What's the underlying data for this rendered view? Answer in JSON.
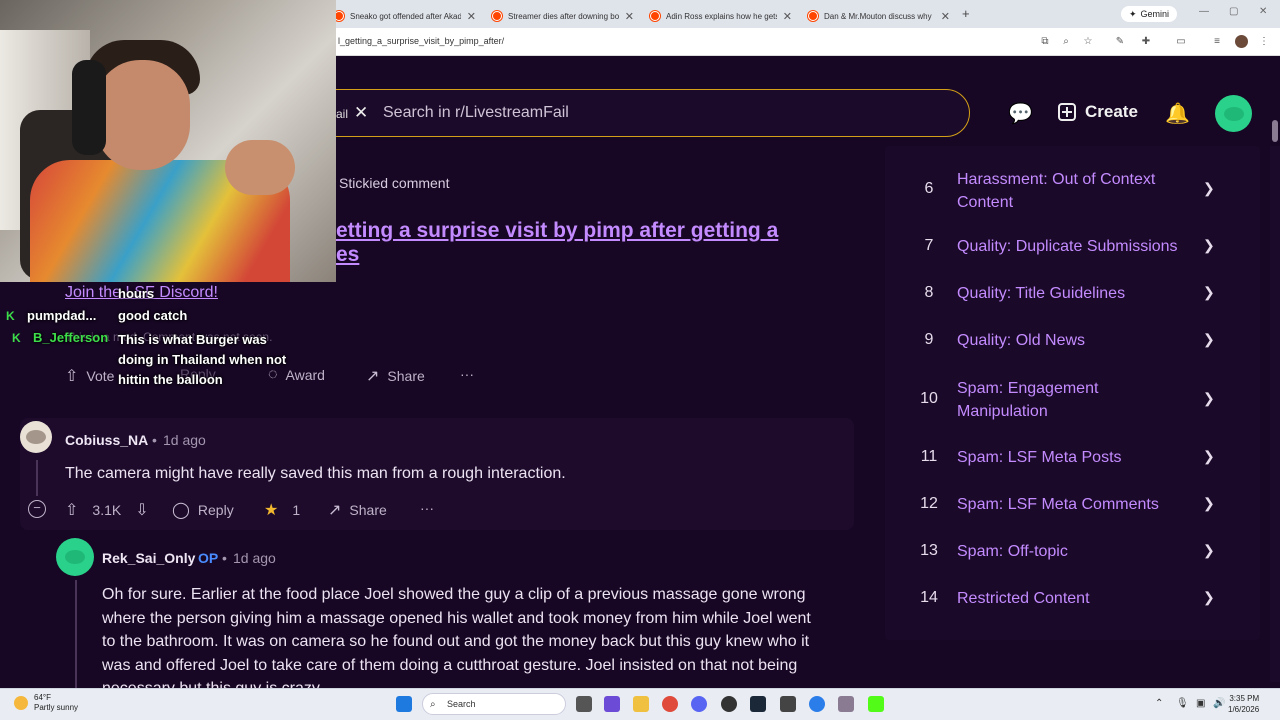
{
  "browser": {
    "tabs": [
      {
        "title": "Sneako got offended after Akad"
      },
      {
        "title": "Streamer dies after downing bo"
      },
      {
        "title": "Adin Ross explains how he gets"
      },
      {
        "title": "Dan & Mr.Mouton discuss why"
      }
    ],
    "new_tab": "+",
    "gemini_label": "Gemini",
    "url": "l_getting_a_surprise_visit_by_pimp_after/"
  },
  "header": {
    "chip_label": "ail",
    "search_placeholder": "Search in r/LivestreamFail",
    "create_label": "Create"
  },
  "chat": [
    {
      "user": "",
      "message": "hours"
    },
    {
      "user": "pumpdad...",
      "message": "good catch"
    },
    {
      "user": "B_Jefferson",
      "message": "This is what Burger was doing in Thailand when not hittin the balloon"
    }
  ],
  "post": {
    "stickied_label": "Stickied comment",
    "title_line1": "etting a surprise visit by pimp after getting a",
    "title_line2": "es",
    "discord_link": "Join the LSF Discord!",
    "faint_text": "This is a mod. Comment was not seen.",
    "actions": {
      "vote": "Vote",
      "reply": "Reply",
      "award": "Award",
      "share": "Share",
      "more": "···"
    }
  },
  "comments": [
    {
      "user": "Cobiuss_NA",
      "sep": "•",
      "time": "1d ago",
      "text": "The camera might have really saved this man from a rough interaction.",
      "votes": "3.1K",
      "reply": "Reply",
      "award_count": "1",
      "share": "Share",
      "more": "···"
    },
    {
      "user": "Rek_Sai_Only",
      "op": "OP",
      "sep": "•",
      "time": "1d ago",
      "lines": [
        "Oh for sure. Earlier at the food place Joel showed the guy a clip of a previous massage gone wrong",
        "where the person giving him a massage opened his wallet and took money from him while Joel went",
        "to the bathroom. It was on camera so he found out and got the money back but this guy knew who it",
        "was and offered Joel to take care of them doing a cutthroat gesture. Joel insisted on that not being",
        "necessary but this guy is crazy"
      ]
    }
  ],
  "rules": [
    {
      "num": "6",
      "line1": "Harassment: Out of Context",
      "line2": "Content"
    },
    {
      "num": "7",
      "line1": "Quality: Duplicate Submissions",
      "line2": ""
    },
    {
      "num": "8",
      "line1": "Quality: Title Guidelines",
      "line2": ""
    },
    {
      "num": "9",
      "line1": "Quality: Old News",
      "line2": ""
    },
    {
      "num": "10",
      "line1": "Spam: Engagement",
      "line2": "Manipulation"
    },
    {
      "num": "11",
      "line1": "Spam: LSF Meta Posts",
      "line2": ""
    },
    {
      "num": "12",
      "line1": "Spam: LSF Meta Comments",
      "line2": ""
    },
    {
      "num": "13",
      "line1": "Spam: Off-topic",
      "line2": ""
    },
    {
      "num": "14",
      "line1": "Restricted Content",
      "line2": ""
    }
  ],
  "taskbar": {
    "weather_temp": "64°F",
    "weather_desc": "Partly sunny",
    "search_label": "Search",
    "time": "3:35 PM",
    "date": "1/6/2026"
  },
  "colors": {
    "accent": "#c38bff",
    "background": "#170724",
    "op_blue": "#4a8cff",
    "search_border": "#d4a017"
  }
}
